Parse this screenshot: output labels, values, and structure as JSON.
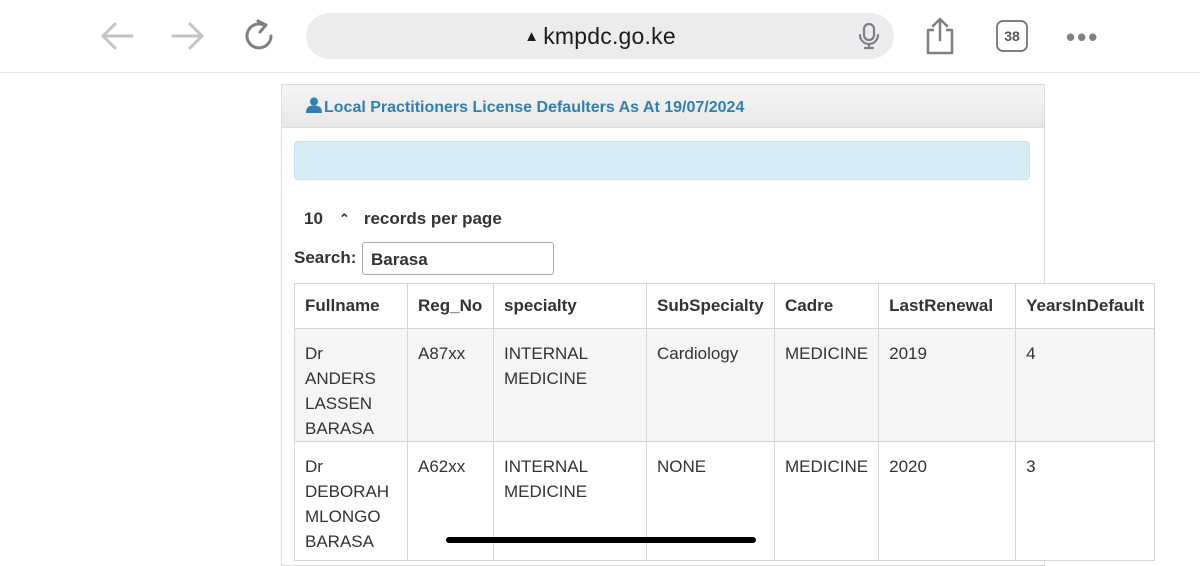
{
  "browser": {
    "url": "kmpdc.go.ke",
    "tab_count": "38",
    "icons": [
      "back-arrow-icon",
      "forward-arrow-icon",
      "reload-icon",
      "warning-icon",
      "microphone-icon",
      "share-icon",
      "tabs-icon",
      "more-icon"
    ]
  },
  "panel": {
    "title": "Local Practitioners License Defaulters As At 19/07/2024",
    "title_icon": "person-icon",
    "title_color": "#2f7fb3",
    "alert_color": "#d9edf7"
  },
  "controls": {
    "page_length": "10",
    "records_per_page_label": "records per page",
    "search_label": "Search:",
    "search_value": "Barasa"
  },
  "table": {
    "headers": [
      "Fullname",
      "Reg_No",
      "specialty",
      "SubSpecialty",
      "Cadre",
      "LastRenewal",
      "YearsInDefault"
    ],
    "rows": [
      {
        "fullname": [
          "Dr ANDERS",
          "LASSEN",
          "BARASA"
        ],
        "reg_no": "A87xx",
        "specialty": [
          "INTERNAL",
          "MEDICINE"
        ],
        "subspecialty": "Cardiology",
        "cadre": "MEDICINE",
        "last_renewal": "2019",
        "years_in_default": "4"
      },
      {
        "fullname": [
          "Dr",
          "DEBORAH",
          "MLONGO",
          "BARASA"
        ],
        "reg_no": "A62xx",
        "specialty": [
          "INTERNAL",
          "MEDICINE"
        ],
        "subspecialty": "NONE",
        "cadre": "MEDICINE",
        "last_renewal": "2020",
        "years_in_default": "3"
      }
    ]
  }
}
